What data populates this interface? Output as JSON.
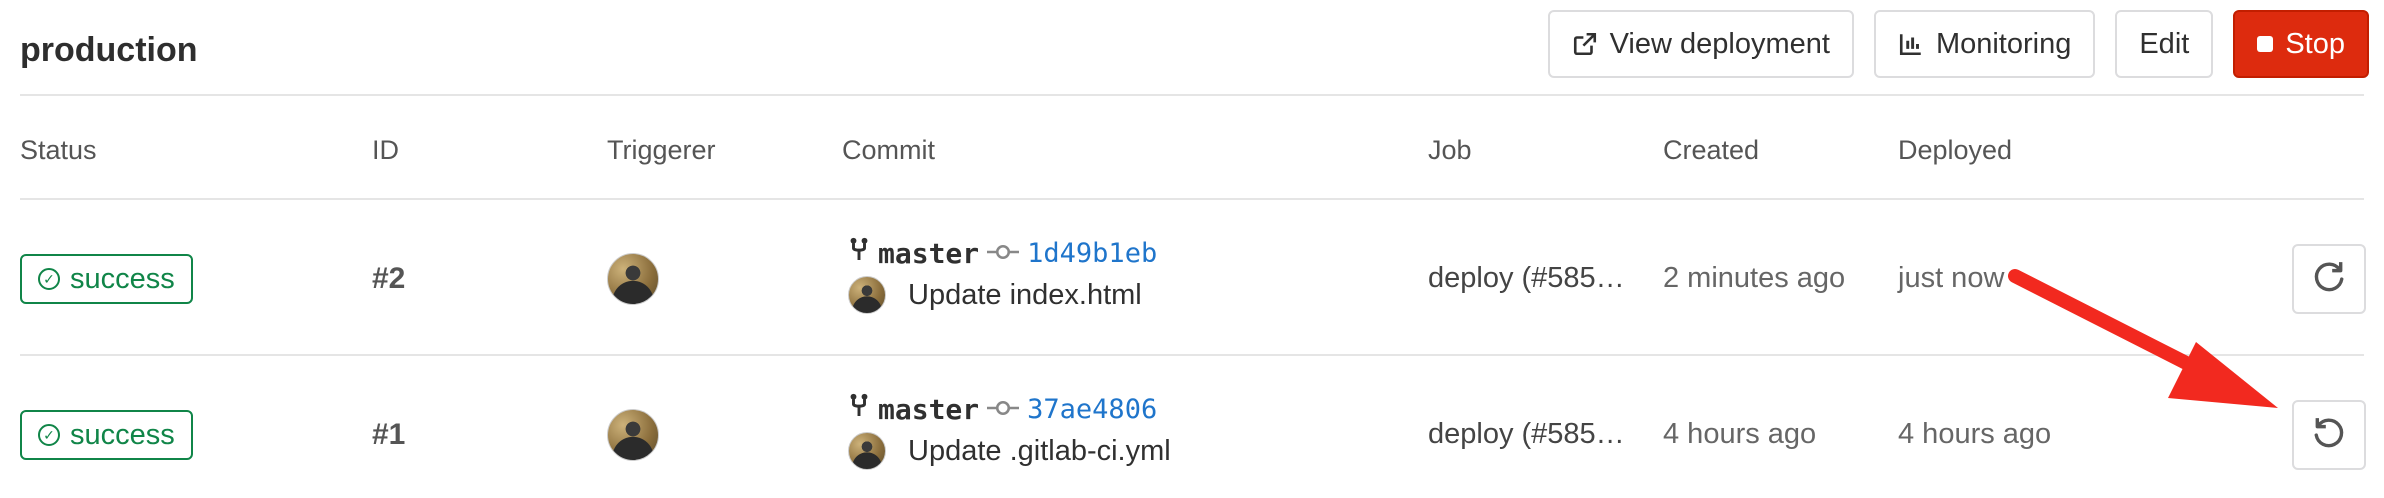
{
  "environment": {
    "name": "production"
  },
  "toolbar": {
    "view_deployment": "View deployment",
    "monitoring": "Monitoring",
    "edit": "Edit",
    "stop": "Stop",
    "stop_color": "#dd2b0e"
  },
  "table": {
    "headers": [
      "Status",
      "ID",
      "Triggerer",
      "Commit",
      "Job",
      "Created",
      "Deployed"
    ],
    "rows": [
      {
        "status": "success",
        "id": "#2",
        "branch": "master",
        "sha": "1d49b1eb",
        "message": "Update index.html",
        "job": "deploy (#585…",
        "created": "2 minutes ago",
        "deployed": "just now",
        "action_icon": "retry-icon"
      },
      {
        "status": "success",
        "id": "#1",
        "branch": "master",
        "sha": "37ae4806",
        "message": "Update .gitlab-ci.yml",
        "job": "deploy (#585…",
        "created": "4 hours ago",
        "deployed": "4 hours ago",
        "action_icon": "rollback-icon"
      }
    ]
  },
  "colors": {
    "success": "#108548",
    "link": "#1f75cb",
    "annotation_arrow": "#f2291f"
  }
}
